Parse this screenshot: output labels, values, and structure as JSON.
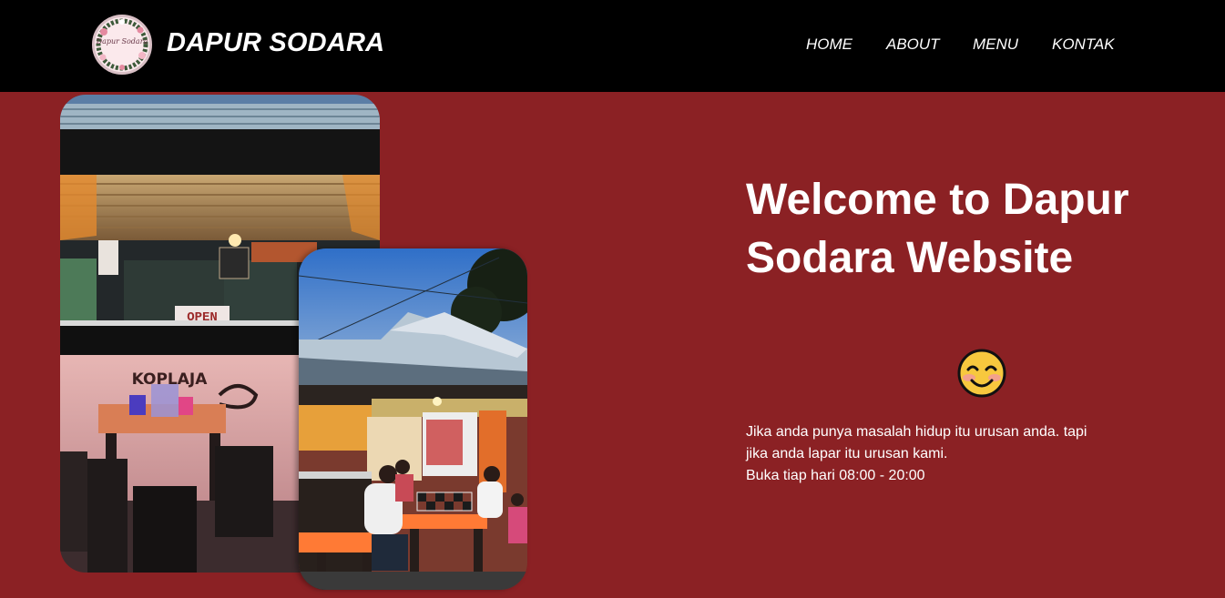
{
  "nav": {
    "brand": "DAPUR SODARA",
    "logo_text": "Dapur Sodara",
    "links": [
      "HOME",
      "ABOUT",
      "MENU",
      "KONTAK"
    ]
  },
  "hero": {
    "title": "Welcome to Dapur Sodara Website",
    "emoji": "smiling-face-icon",
    "description": "Jika anda punya masalah hidup itu urusan anda. tapi jika anda lapar itu urusan kami.",
    "hours": "Buka tiap hari 08:00 - 20:00"
  },
  "photos": {
    "back_sign_open": "OPEN",
    "back_sign_koplaja": "KOPLAJA"
  },
  "colors": {
    "background": "#8b2124",
    "navbar": "#000000",
    "text": "#ffffff"
  }
}
